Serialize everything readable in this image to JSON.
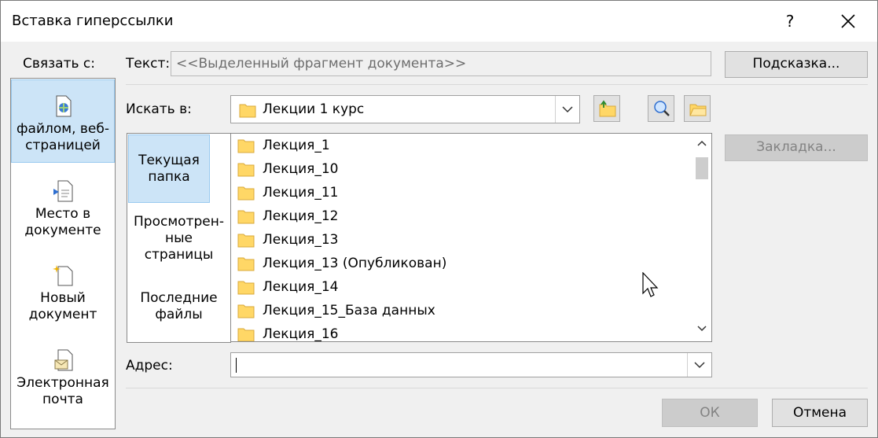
{
  "window": {
    "title": "Вставка гиперссылки",
    "help_glyph": "?"
  },
  "link_with": {
    "label": "Связать с:",
    "items": [
      {
        "line1": "файлом, веб-",
        "line2": "страницей",
        "icon": "web-page-icon",
        "selected": true
      },
      {
        "line1": "Место в",
        "line2": "документе",
        "icon": "place-in-document-icon",
        "selected": false
      },
      {
        "line1": "Новый",
        "line2": "документ",
        "icon": "new-document-icon",
        "selected": false
      },
      {
        "line1": "Электронная",
        "line2": "почта",
        "icon": "email-icon",
        "selected": false
      }
    ]
  },
  "text_field": {
    "label": "Текст:",
    "value": "<<Выделенный фрагмент документа>>"
  },
  "hint_button": "Подсказка...",
  "look_in": {
    "label": "Искать в:",
    "value": "Лекции 1 курс"
  },
  "toolbar": [
    "up-folder-icon",
    "browse-web-icon",
    "browse-file-icon"
  ],
  "nav": {
    "items": [
      {
        "line1": "Текущая",
        "line2": "папка",
        "line3": "",
        "selected": true
      },
      {
        "line1": "Просмотрен-",
        "line2": "ные",
        "line3": "страницы",
        "selected": false
      },
      {
        "line1": "Последние",
        "line2": "файлы",
        "line3": "",
        "selected": false
      }
    ]
  },
  "files": [
    "Лекция_1",
    "Лекция_10",
    "Лекция_11",
    "Лекция_12",
    "Лекция_13",
    "Лекция_13 (Опубликован)",
    "Лекция_14",
    "Лекция_15_База данных",
    "Лекция_16"
  ],
  "bookmark_button": "Закладка...",
  "address": {
    "label": "Адрес:",
    "value": ""
  },
  "ok_button": "ОК",
  "cancel_button": "Отмена",
  "colors": {
    "selection": "#cce4f7",
    "folder": "#ffd766"
  }
}
